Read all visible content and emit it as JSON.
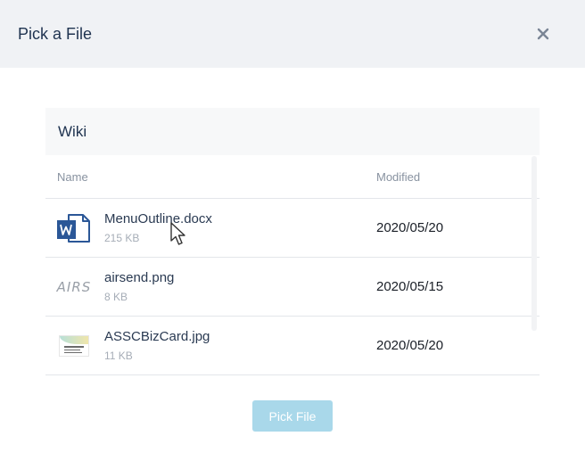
{
  "dialog": {
    "title": "Pick a File",
    "close_icon": "close-icon"
  },
  "folder": {
    "name": "Wiki"
  },
  "table": {
    "columns": [
      "Name",
      "Modified"
    ],
    "rows": [
      {
        "name": "MenuOutline.docx",
        "size": "215 KB",
        "modified": "2020/05/20",
        "icon": "word-doc-icon"
      },
      {
        "name": "airsend.png",
        "size": "8 KB",
        "modified": "2020/05/15",
        "icon": "airsend-logo-thumbnail",
        "thumb_text": "AIRS"
      },
      {
        "name": "ASSCBizCard.jpg",
        "size": "11 KB",
        "modified": "2020/05/20",
        "icon": "business-card-thumbnail"
      }
    ]
  },
  "footer": {
    "pick_label": "Pick File"
  },
  "colors": {
    "header_bg": "#f0f2f5",
    "primary_button_disabled": "#a9d8ea",
    "word_blue": "#2b5797"
  }
}
